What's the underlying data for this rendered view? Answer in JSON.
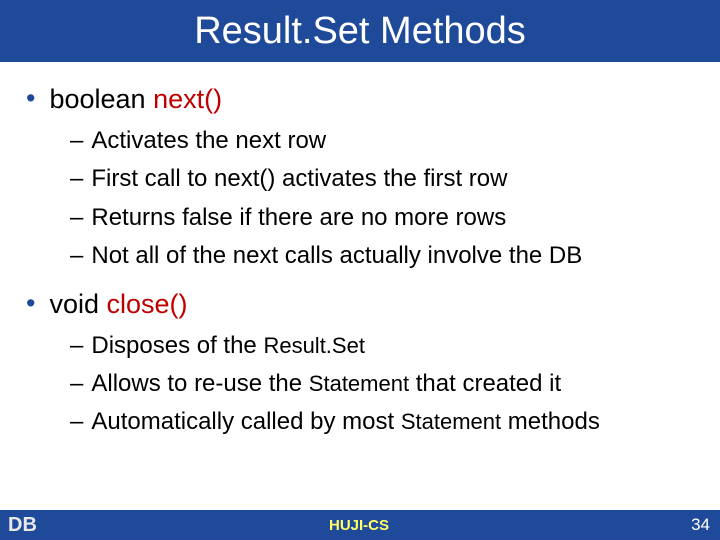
{
  "title": "Result.Set Methods",
  "bullets": [
    {
      "prefix": "boolean ",
      "method": "next()",
      "subs": [
        "Activates the next row",
        "First call to next() activates the first row",
        "Returns false if there are no more rows",
        "Not all of the next calls actually involve the DB"
      ]
    },
    {
      "prefix": "void ",
      "method": "close()",
      "subs_rich": [
        {
          "parts": [
            "Disposes of the ",
            {
              "code": "Result.Set"
            }
          ]
        },
        {
          "parts": [
            "Allows to re-use the ",
            {
              "code": "Statement"
            },
            " that created it"
          ]
        },
        {
          "parts": [
            "Automatically called by most ",
            {
              "code": "Statement"
            },
            " methods"
          ]
        }
      ]
    }
  ],
  "footer": {
    "left": "DB",
    "center": "HUJI-CS",
    "page": "34"
  }
}
